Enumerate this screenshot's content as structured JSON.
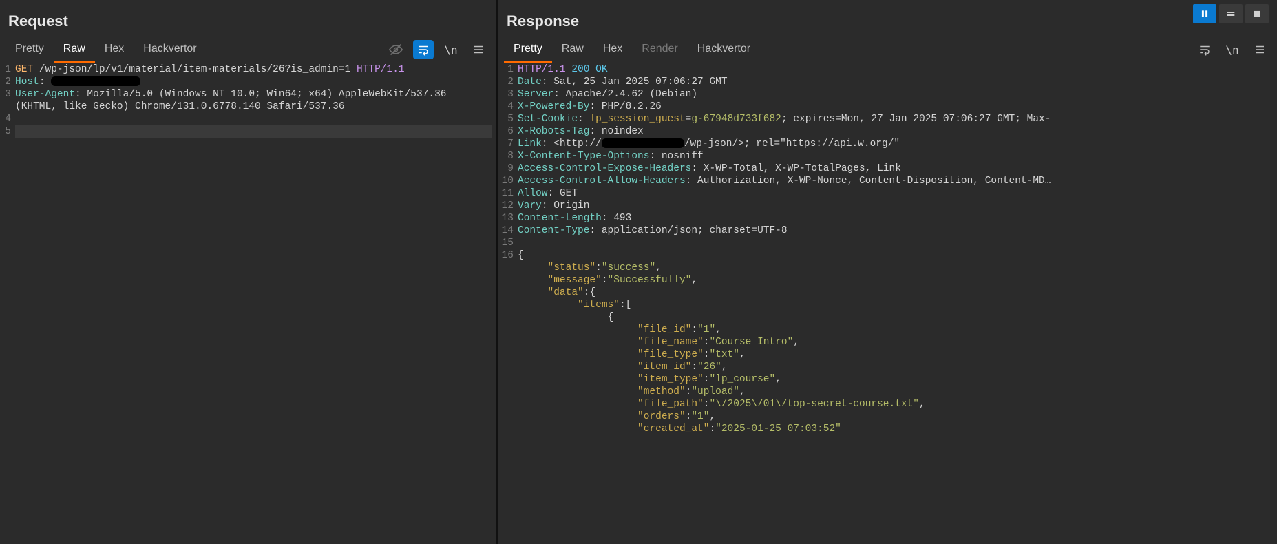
{
  "request": {
    "title": "Request",
    "tabs": [
      "Pretty",
      "Raw",
      "Hex",
      "Hackvertor"
    ],
    "active_tab": "Raw",
    "lines": [
      {
        "n": 1,
        "segs": [
          {
            "t": "GET",
            "c": "method"
          },
          {
            "t": " "
          },
          {
            "t": "/wp-json/lp/v1/material/item-materials/26?is_admin=1",
            "c": "white"
          },
          {
            "t": " "
          },
          {
            "t": "HTTP/1.1",
            "c": "kw"
          }
        ]
      },
      {
        "n": 2,
        "segs": [
          {
            "t": "Host",
            "c": "tok-teal"
          },
          {
            "t": ": "
          },
          {
            "redact": "r1"
          }
        ]
      },
      {
        "n": 3,
        "segs": [
          {
            "t": "User-Agent",
            "c": "tok-teal"
          },
          {
            "t": ": "
          },
          {
            "t": "Mozilla/5.0 (Windows NT 10.0; Win64; x64) AppleWebKit/537.36",
            "c": "white"
          }
        ]
      },
      {
        "n": "",
        "segs": [
          {
            "t": "(KHTML, like Gecko) Chrome/131.0.6778.140 Safari/537.36",
            "c": "white"
          }
        ]
      },
      {
        "n": 4,
        "segs": [
          {
            "t": ""
          }
        ]
      },
      {
        "n": 5,
        "segs": [
          {
            "t": ""
          }
        ],
        "caret": true
      }
    ]
  },
  "response": {
    "title": "Response",
    "tabs": [
      "Pretty",
      "Raw",
      "Hex",
      "Render",
      "Hackvertor"
    ],
    "active_tab": "Pretty",
    "dim_tabs": [
      "Render"
    ],
    "lines": [
      {
        "n": 1,
        "segs": [
          {
            "t": "HTTP/1.1",
            "c": "kw"
          },
          {
            "t": " "
          },
          {
            "t": "200 OK",
            "c": "tok-cyan"
          }
        ]
      },
      {
        "n": 2,
        "segs": [
          {
            "t": "Date",
            "c": "tok-teal"
          },
          {
            "t": ": "
          },
          {
            "t": "Sat, 25 Jan 2025 07:06:27 GMT",
            "c": "white"
          }
        ]
      },
      {
        "n": 3,
        "segs": [
          {
            "t": "Server",
            "c": "tok-teal"
          },
          {
            "t": ": "
          },
          {
            "t": "Apache/2.4.62 (Debian)",
            "c": "white"
          }
        ]
      },
      {
        "n": 4,
        "segs": [
          {
            "t": "X-Powered-By",
            "c": "tok-teal"
          },
          {
            "t": ": "
          },
          {
            "t": "PHP/8.2.26",
            "c": "white"
          }
        ]
      },
      {
        "n": 5,
        "segs": [
          {
            "t": "Set-Cookie",
            "c": "tok-teal"
          },
          {
            "t": ": "
          },
          {
            "t": "lp_session_guest",
            "c": "tok-gold"
          },
          {
            "t": "="
          },
          {
            "t": "g-67948d733f682",
            "c": "tok-olive"
          },
          {
            "t": "; expires=Mon, 27 Jan 2025 07:06:27 GMT; Max-",
            "c": "white"
          }
        ]
      },
      {
        "n": 6,
        "segs": [
          {
            "t": "X-Robots-Tag",
            "c": "tok-teal"
          },
          {
            "t": ": "
          },
          {
            "t": "noindex",
            "c": "white"
          }
        ]
      },
      {
        "n": 7,
        "segs": [
          {
            "t": "Link",
            "c": "tok-teal"
          },
          {
            "t": ": "
          },
          {
            "t": "<http://",
            "c": "white"
          },
          {
            "redact": "r2"
          },
          {
            "t": "/wp-json/>; rel=\"https://api.w.org/\"",
            "c": "white"
          }
        ]
      },
      {
        "n": 8,
        "segs": [
          {
            "t": "X-Content-Type-Options",
            "c": "tok-teal"
          },
          {
            "t": ": "
          },
          {
            "t": "nosniff",
            "c": "white"
          }
        ]
      },
      {
        "n": 9,
        "segs": [
          {
            "t": "Access-Control-Expose-Headers",
            "c": "tok-teal"
          },
          {
            "t": ": "
          },
          {
            "t": "X-WP-Total, X-WP-TotalPages, Link",
            "c": "white"
          }
        ]
      },
      {
        "n": 10,
        "segs": [
          {
            "t": "Access-Control-Allow-Headers",
            "c": "tok-teal"
          },
          {
            "t": ": "
          },
          {
            "t": "Authorization, X-WP-Nonce, Content-Disposition, Content-MD…",
            "c": "white"
          }
        ]
      },
      {
        "n": 11,
        "segs": [
          {
            "t": "Allow",
            "c": "tok-teal"
          },
          {
            "t": ": "
          },
          {
            "t": "GET",
            "c": "white"
          }
        ]
      },
      {
        "n": 12,
        "segs": [
          {
            "t": "Vary",
            "c": "tok-teal"
          },
          {
            "t": ": "
          },
          {
            "t": "Origin",
            "c": "white"
          }
        ]
      },
      {
        "n": 13,
        "segs": [
          {
            "t": "Content-Length",
            "c": "tok-teal"
          },
          {
            "t": ": "
          },
          {
            "t": "493",
            "c": "white"
          }
        ]
      },
      {
        "n": 14,
        "segs": [
          {
            "t": "Content-Type",
            "c": "tok-teal"
          },
          {
            "t": ": "
          },
          {
            "t": "application/json; charset=UTF-8",
            "c": "white"
          }
        ]
      },
      {
        "n": 15,
        "segs": [
          {
            "t": ""
          }
        ]
      },
      {
        "n": 16,
        "segs": [
          {
            "t": "{",
            "c": "white"
          }
        ]
      },
      {
        "n": "",
        "segs": [
          {
            "t": "     "
          },
          {
            "t": "\"status\"",
            "c": "tok-gold"
          },
          {
            "t": ":"
          },
          {
            "t": "\"success\"",
            "c": "tok-olive"
          },
          {
            "t": ",",
            "c": "white"
          }
        ]
      },
      {
        "n": "",
        "segs": [
          {
            "t": "     "
          },
          {
            "t": "\"message\"",
            "c": "tok-gold"
          },
          {
            "t": ":"
          },
          {
            "t": "\"Successfully\"",
            "c": "tok-olive"
          },
          {
            "t": ",",
            "c": "white"
          }
        ]
      },
      {
        "n": "",
        "segs": [
          {
            "t": "     "
          },
          {
            "t": "\"data\"",
            "c": "tok-gold"
          },
          {
            "t": ":{",
            "c": "white"
          }
        ]
      },
      {
        "n": "",
        "segs": [
          {
            "t": "          "
          },
          {
            "t": "\"items\"",
            "c": "tok-gold"
          },
          {
            "t": ":[",
            "c": "white"
          }
        ]
      },
      {
        "n": "",
        "segs": [
          {
            "t": "               {",
            "c": "white"
          }
        ]
      },
      {
        "n": "",
        "segs": [
          {
            "t": "                    "
          },
          {
            "t": "\"file_id\"",
            "c": "tok-gold"
          },
          {
            "t": ":"
          },
          {
            "t": "\"1\"",
            "c": "tok-olive"
          },
          {
            "t": ",",
            "c": "white"
          }
        ]
      },
      {
        "n": "",
        "segs": [
          {
            "t": "                    "
          },
          {
            "t": "\"file_name\"",
            "c": "tok-gold"
          },
          {
            "t": ":"
          },
          {
            "t": "\"Course Intro\"",
            "c": "tok-olive"
          },
          {
            "t": ",",
            "c": "white"
          }
        ]
      },
      {
        "n": "",
        "segs": [
          {
            "t": "                    "
          },
          {
            "t": "\"file_type\"",
            "c": "tok-gold"
          },
          {
            "t": ":"
          },
          {
            "t": "\"txt\"",
            "c": "tok-olive"
          },
          {
            "t": ",",
            "c": "white"
          }
        ]
      },
      {
        "n": "",
        "segs": [
          {
            "t": "                    "
          },
          {
            "t": "\"item_id\"",
            "c": "tok-gold"
          },
          {
            "t": ":"
          },
          {
            "t": "\"26\"",
            "c": "tok-olive"
          },
          {
            "t": ",",
            "c": "white"
          }
        ]
      },
      {
        "n": "",
        "segs": [
          {
            "t": "                    "
          },
          {
            "t": "\"item_type\"",
            "c": "tok-gold"
          },
          {
            "t": ":"
          },
          {
            "t": "\"lp_course\"",
            "c": "tok-olive"
          },
          {
            "t": ",",
            "c": "white"
          }
        ]
      },
      {
        "n": "",
        "segs": [
          {
            "t": "                    "
          },
          {
            "t": "\"method\"",
            "c": "tok-gold"
          },
          {
            "t": ":"
          },
          {
            "t": "\"upload\"",
            "c": "tok-olive"
          },
          {
            "t": ",",
            "c": "white"
          }
        ]
      },
      {
        "n": "",
        "segs": [
          {
            "t": "                    "
          },
          {
            "t": "\"file_path\"",
            "c": "tok-gold"
          },
          {
            "t": ":"
          },
          {
            "t": "\"\\/2025\\/01\\/top-secret-course.txt\"",
            "c": "tok-olive"
          },
          {
            "t": ",",
            "c": "white"
          }
        ]
      },
      {
        "n": "",
        "segs": [
          {
            "t": "                    "
          },
          {
            "t": "\"orders\"",
            "c": "tok-gold"
          },
          {
            "t": ":"
          },
          {
            "t": "\"1\"",
            "c": "tok-olive"
          },
          {
            "t": ",",
            "c": "white"
          }
        ]
      },
      {
        "n": "",
        "segs": [
          {
            "t": "                    "
          },
          {
            "t": "\"created_at\"",
            "c": "tok-gold"
          },
          {
            "t": ":"
          },
          {
            "t": "\"2025-01-25 07:03:52\"",
            "c": "tok-olive"
          }
        ]
      }
    ]
  },
  "icons": {
    "eye_off": "eye-off-icon",
    "wrap": "wrap-icon",
    "newline": "newline-icon",
    "menu": "menu-icon",
    "pause": "pause-icon",
    "equal": "equal-icon",
    "stop": "stop-icon"
  }
}
